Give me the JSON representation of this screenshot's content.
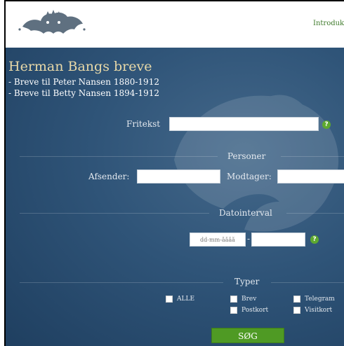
{
  "header": {
    "nav_link": "Introdukt"
  },
  "page": {
    "title": "Herman Bangs breve",
    "subtitles": [
      "- Breve til Peter Nansen 1880-1912",
      "- Breve til Betty Nansen 1894-1912"
    ]
  },
  "search": {
    "fritekst_label": "Fritekst",
    "fritekst_value": "",
    "help_glyph": "?"
  },
  "personer": {
    "section_label": "Personer",
    "afsender_label": "Afsender:",
    "afsender_value": "",
    "modtager_label": "Modtager:",
    "modtager_value": ""
  },
  "dato": {
    "section_label": "Datointerval",
    "from_placeholder": "dd-mm-åååå",
    "separator": "-",
    "to_value": ""
  },
  "typer": {
    "section_label": "Typer",
    "options": {
      "alle": "ALLE",
      "brev": "Brev",
      "postkort": "Postkort",
      "telegram": "Telegram",
      "visitkort": "Visitkort"
    }
  },
  "submit_label": "SØG",
  "colors": {
    "panel_bg": "#2f5478",
    "title": "#e8d9a8",
    "accent_green": "#4f9a24",
    "nav_link": "#3e7a2a"
  },
  "icons": {
    "logo": "lion-crest-logo",
    "help": "help-icon"
  }
}
